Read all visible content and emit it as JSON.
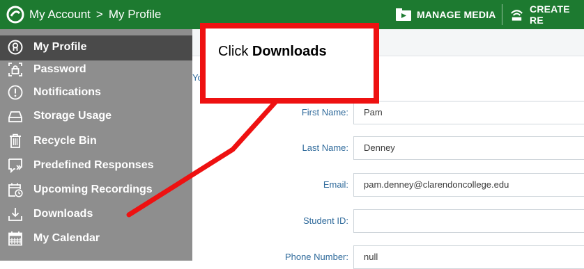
{
  "header": {
    "breadcrumb": [
      "My Account",
      "My Profile"
    ],
    "separator": ">",
    "manage_media": "MANAGE MEDIA",
    "create": "CREATE RE",
    "bg_color": "#1d7a30"
  },
  "sidebar": {
    "items": [
      {
        "label": "My Profile",
        "icon": "profile-icon",
        "selected": true
      },
      {
        "label": "Password",
        "icon": "lock-icon"
      },
      {
        "label": "Notifications",
        "icon": "alert-icon"
      },
      {
        "label": "Storage Usage",
        "icon": "storage-icon"
      },
      {
        "label": "Recycle Bin",
        "icon": "trash-icon"
      },
      {
        "label": "Predefined Responses",
        "icon": "chat-reply-icon"
      },
      {
        "label": "Upcoming Recordings",
        "icon": "calendar-clock-icon"
      },
      {
        "label": "Downloads",
        "icon": "download-icon"
      },
      {
        "label": "My Calendar",
        "icon": "calendar-icon"
      }
    ]
  },
  "form": {
    "partial_text": "Yo",
    "fields": [
      {
        "label": "First Name:",
        "value": "Pam"
      },
      {
        "label": "Last Name:",
        "value": "Denney"
      },
      {
        "label": "Email:",
        "value": "pam.denney@clarendoncollege.edu"
      },
      {
        "label": "Student ID:",
        "value": ""
      },
      {
        "label": "Phone Number:",
        "value": "null"
      }
    ]
  },
  "callout": {
    "prefix": "Click ",
    "emphasis": "Downloads",
    "color": "#ee1111"
  }
}
